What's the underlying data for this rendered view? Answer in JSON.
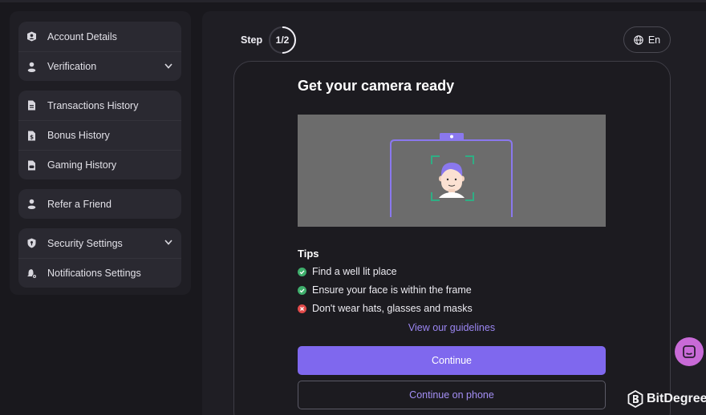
{
  "sidebar": {
    "groups": [
      {
        "items": [
          {
            "label": "Account Details",
            "icon": "account-icon"
          },
          {
            "label": "Verification",
            "icon": "user-icon",
            "expandable": true
          }
        ]
      },
      {
        "items": [
          {
            "label": "Transactions History",
            "icon": "document-icon"
          },
          {
            "label": "Bonus History",
            "icon": "document-dollar-icon"
          },
          {
            "label": "Gaming History",
            "icon": "document-game-icon"
          }
        ]
      },
      {
        "items": [
          {
            "label": "Refer a Friend",
            "icon": "user-icon"
          }
        ]
      },
      {
        "items": [
          {
            "label": "Security Settings",
            "icon": "shield-icon",
            "expandable": true
          },
          {
            "label": "Notifications Settings",
            "icon": "bell-gear-icon"
          }
        ]
      }
    ]
  },
  "step": {
    "label": "Step",
    "current": "1/2",
    "progress": 0.5
  },
  "language": {
    "label": "En",
    "icon": "globe-icon"
  },
  "card": {
    "title": "Get your camera ready",
    "tips_heading": "Tips",
    "tips": [
      {
        "text": "Find a well lit place",
        "status": "ok"
      },
      {
        "text": "Ensure your face is within the frame",
        "status": "ok"
      },
      {
        "text": "Don't wear hats, glasses and masks",
        "status": "bad"
      }
    ],
    "guidelines_link": "View our guidelines",
    "continue_label": "Continue",
    "continue_phone_label": "Continue on phone"
  },
  "watermark": {
    "brand": "BitDegree"
  },
  "colors": {
    "accent": "#7f68ee",
    "ok": "#3fae6c",
    "bad": "#e24a4a",
    "chat": "#c86ad7"
  }
}
